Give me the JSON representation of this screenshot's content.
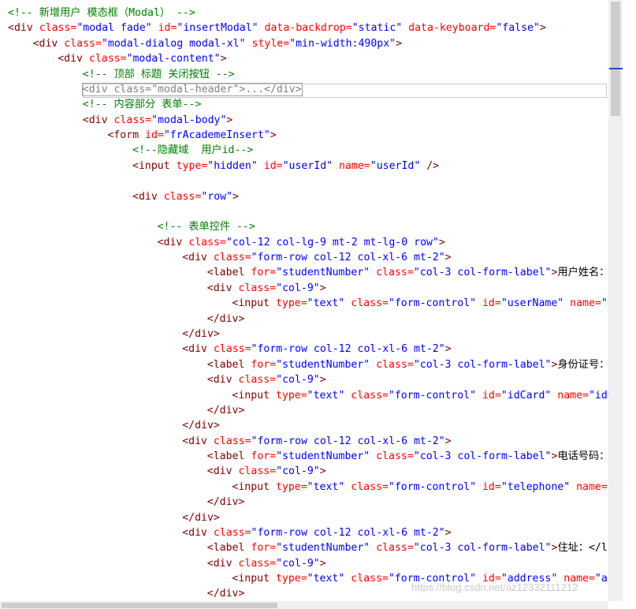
{
  "code_lines": [
    [
      {
        "t": "<!-- 新增用户 模态框（Modal） -->",
        "c": "comment"
      }
    ],
    [
      {
        "t": "<div ",
        "c": "tag"
      },
      {
        "t": "class=",
        "c": "attr"
      },
      {
        "t": "\"modal fade\"",
        "c": "value"
      },
      {
        "t": " id=",
        "c": "attr"
      },
      {
        "t": "\"insertModal\"",
        "c": "value"
      },
      {
        "t": " data-backdrop=",
        "c": "attr"
      },
      {
        "t": "\"static\"",
        "c": "value"
      },
      {
        "t": " data-keyboard=",
        "c": "attr"
      },
      {
        "t": "\"false\"",
        "c": "value"
      },
      {
        "t": ">",
        "c": "tag"
      }
    ],
    [
      {
        "t": "<div ",
        "c": "tag"
      },
      {
        "t": "class=",
        "c": "attr"
      },
      {
        "t": "\"modal-dialog modal-xl\"",
        "c": "value"
      },
      {
        "t": " style=",
        "c": "attr"
      },
      {
        "t": "\"min-width:490px\"",
        "c": "value"
      },
      {
        "t": ">",
        "c": "tag"
      }
    ],
    [
      {
        "t": "<div ",
        "c": "tag"
      },
      {
        "t": "class=",
        "c": "attr"
      },
      {
        "t": "\"modal-content\"",
        "c": "value"
      },
      {
        "t": ">",
        "c": "tag"
      }
    ],
    [
      {
        "t": "<!-- 顶部 标题 关闭按钮 -->",
        "c": "comment"
      }
    ],
    [
      {
        "t": "<div class=\"modal-header\">...</div>",
        "c": "collapsed"
      }
    ],
    [
      {
        "t": "<!-- 内容部分 表单-->",
        "c": "comment"
      }
    ],
    [
      {
        "t": "<div ",
        "c": "tag"
      },
      {
        "t": "class=",
        "c": "attr"
      },
      {
        "t": "\"modal-body\"",
        "c": "value"
      },
      {
        "t": ">",
        "c": "tag"
      }
    ],
    [
      {
        "t": "<form ",
        "c": "tag"
      },
      {
        "t": "id=",
        "c": "attr"
      },
      {
        "t": "\"frAcademeInsert\"",
        "c": "value"
      },
      {
        "t": ">",
        "c": "tag"
      }
    ],
    [
      {
        "t": "<!--隐藏域  用户id-->",
        "c": "comment"
      }
    ],
    [
      {
        "t": "<input ",
        "c": "tag"
      },
      {
        "t": "type=",
        "c": "attr"
      },
      {
        "t": "\"hidden\"",
        "c": "value"
      },
      {
        "t": " id=",
        "c": "attr"
      },
      {
        "t": "\"userId\"",
        "c": "value"
      },
      {
        "t": " name=",
        "c": "attr"
      },
      {
        "t": "\"userId\"",
        "c": "value"
      },
      {
        "t": " />",
        "c": "tag"
      }
    ],
    [],
    [
      {
        "t": "<div ",
        "c": "tag"
      },
      {
        "t": "class=",
        "c": "attr"
      },
      {
        "t": "\"row\"",
        "c": "value"
      },
      {
        "t": ">",
        "c": "tag"
      }
    ],
    [],
    [
      {
        "t": "<!-- 表单控件 -->",
        "c": "comment"
      }
    ],
    [
      {
        "t": "<div ",
        "c": "tag"
      },
      {
        "t": "class=",
        "c": "attr"
      },
      {
        "t": "\"col-12 col-lg-9 mt-2 mt-lg-0 row\"",
        "c": "value"
      },
      {
        "t": ">",
        "c": "tag"
      }
    ],
    [
      {
        "t": "<div ",
        "c": "tag"
      },
      {
        "t": "class=",
        "c": "attr"
      },
      {
        "t": "\"form-row col-12 col-xl-6 mt-2\"",
        "c": "value"
      },
      {
        "t": ">",
        "c": "tag"
      }
    ],
    [
      {
        "t": "<label ",
        "c": "tag"
      },
      {
        "t": "for=",
        "c": "attr"
      },
      {
        "t": "\"studentNumber\"",
        "c": "value"
      },
      {
        "t": " class=",
        "c": "attr"
      },
      {
        "t": "\"col-3 col-form-label\"",
        "c": "value"
      },
      {
        "t": ">",
        "c": "tag"
      },
      {
        "t": "用户姓名：",
        "c": "text"
      }
    ],
    [
      {
        "t": "<div ",
        "c": "tag"
      },
      {
        "t": "class=",
        "c": "attr"
      },
      {
        "t": "\"col-9\"",
        "c": "value"
      },
      {
        "t": ">",
        "c": "tag"
      }
    ],
    [
      {
        "t": "<input ",
        "c": "tag"
      },
      {
        "t": "type=",
        "c": "attr"
      },
      {
        "t": "\"text\"",
        "c": "value"
      },
      {
        "t": " class=",
        "c": "attr"
      },
      {
        "t": "\"form-control\"",
        "c": "value"
      },
      {
        "t": " id=",
        "c": "attr"
      },
      {
        "t": "\"userName\"",
        "c": "value"
      },
      {
        "t": " name=",
        "c": "attr"
      },
      {
        "t": "\"u",
        "c": "value"
      }
    ],
    [
      {
        "t": "</div>",
        "c": "tag"
      }
    ],
    [
      {
        "t": "</div>",
        "c": "tag"
      }
    ],
    [
      {
        "t": "<div ",
        "c": "tag"
      },
      {
        "t": "class=",
        "c": "attr"
      },
      {
        "t": "\"form-row col-12 col-xl-6 mt-2\"",
        "c": "value"
      },
      {
        "t": ">",
        "c": "tag"
      }
    ],
    [
      {
        "t": "<label ",
        "c": "tag"
      },
      {
        "t": "for=",
        "c": "attr"
      },
      {
        "t": "\"studentNumber\"",
        "c": "value"
      },
      {
        "t": " class=",
        "c": "attr"
      },
      {
        "t": "\"col-3 col-form-label\"",
        "c": "value"
      },
      {
        "t": ">",
        "c": "tag"
      },
      {
        "t": "身份证号：",
        "c": "text"
      }
    ],
    [
      {
        "t": "<div ",
        "c": "tag"
      },
      {
        "t": "class=",
        "c": "attr"
      },
      {
        "t": "\"col-9\"",
        "c": "value"
      },
      {
        "t": ">",
        "c": "tag"
      }
    ],
    [
      {
        "t": "<input ",
        "c": "tag"
      },
      {
        "t": "type=",
        "c": "attr"
      },
      {
        "t": "\"text\"",
        "c": "value"
      },
      {
        "t": " class=",
        "c": "attr"
      },
      {
        "t": "\"form-control\"",
        "c": "value"
      },
      {
        "t": " id=",
        "c": "attr"
      },
      {
        "t": "\"idCard\"",
        "c": "value"
      },
      {
        "t": " name=",
        "c": "attr"
      },
      {
        "t": "\"idC",
        "c": "value"
      }
    ],
    [
      {
        "t": "</div>",
        "c": "tag"
      }
    ],
    [
      {
        "t": "</div>",
        "c": "tag"
      }
    ],
    [
      {
        "t": "<div ",
        "c": "tag"
      },
      {
        "t": "class=",
        "c": "attr"
      },
      {
        "t": "\"form-row col-12 col-xl-6 mt-2\"",
        "c": "value"
      },
      {
        "t": ">",
        "c": "tag"
      }
    ],
    [
      {
        "t": "<label ",
        "c": "tag"
      },
      {
        "t": "for=",
        "c": "attr"
      },
      {
        "t": "\"studentNumber\"",
        "c": "value"
      },
      {
        "t": " class=",
        "c": "attr"
      },
      {
        "t": "\"col-3 col-form-label\"",
        "c": "value"
      },
      {
        "t": ">",
        "c": "tag"
      },
      {
        "t": "电话号码：",
        "c": "text"
      }
    ],
    [
      {
        "t": "<div ",
        "c": "tag"
      },
      {
        "t": "class=",
        "c": "attr"
      },
      {
        "t": "\"col-9\"",
        "c": "value"
      },
      {
        "t": ">",
        "c": "tag"
      }
    ],
    [
      {
        "t": "<input ",
        "c": "tag"
      },
      {
        "t": "type=",
        "c": "attr"
      },
      {
        "t": "\"text\"",
        "c": "value"
      },
      {
        "t": " class=",
        "c": "attr"
      },
      {
        "t": "\"form-control\"",
        "c": "value"
      },
      {
        "t": " id=",
        "c": "attr"
      },
      {
        "t": "\"telephone\"",
        "c": "value"
      },
      {
        "t": " name=",
        "c": "attr"
      },
      {
        "t": "\"",
        "c": "value"
      }
    ],
    [
      {
        "t": "</div>",
        "c": "tag"
      }
    ],
    [
      {
        "t": "</div>",
        "c": "tag"
      }
    ],
    [
      {
        "t": "<div ",
        "c": "tag"
      },
      {
        "t": "class=",
        "c": "attr"
      },
      {
        "t": "\"form-row col-12 col-xl-6 mt-2\"",
        "c": "value"
      },
      {
        "t": ">",
        "c": "tag"
      }
    ],
    [
      {
        "t": "<label ",
        "c": "tag"
      },
      {
        "t": "for=",
        "c": "attr"
      },
      {
        "t": "\"studentNumber\"",
        "c": "value"
      },
      {
        "t": " class=",
        "c": "attr"
      },
      {
        "t": "\"col-3 col-form-label\"",
        "c": "value"
      },
      {
        "t": ">",
        "c": "tag"
      },
      {
        "t": "住址：</l",
        "c": "text"
      }
    ],
    [
      {
        "t": "<div ",
        "c": "tag"
      },
      {
        "t": "class=",
        "c": "attr"
      },
      {
        "t": "\"col-9\"",
        "c": "value"
      },
      {
        "t": ">",
        "c": "tag"
      }
    ],
    [
      {
        "t": "<input ",
        "c": "tag"
      },
      {
        "t": "type=",
        "c": "attr"
      },
      {
        "t": "\"text\"",
        "c": "value"
      },
      {
        "t": " class=",
        "c": "attr"
      },
      {
        "t": "\"form-control\"",
        "c": "value"
      },
      {
        "t": " id=",
        "c": "attr"
      },
      {
        "t": "\"address\"",
        "c": "value"
      },
      {
        "t": " name=",
        "c": "attr"
      },
      {
        "t": "\"ac",
        "c": "value"
      }
    ],
    [
      {
        "t": "</div>",
        "c": "tag"
      }
    ]
  ],
  "watermark": "https://blog.csdn.net/az12332111212",
  "colors": {
    "comment": "#008000",
    "tag": "#800000",
    "attr": "#ff0000",
    "value": "#0000ff",
    "text": "#000000",
    "collapsed": "#808080"
  }
}
